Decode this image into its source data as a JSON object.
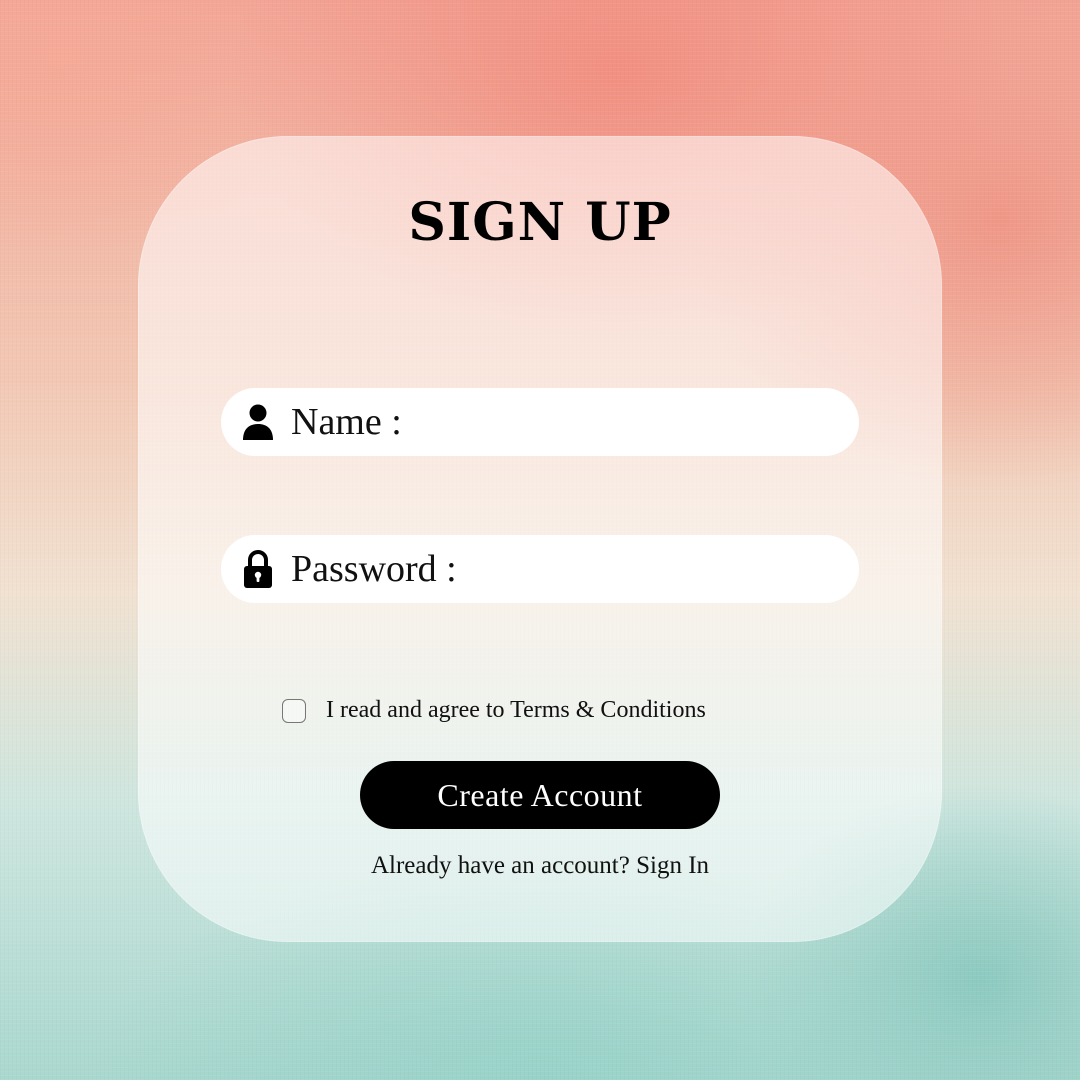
{
  "form": {
    "title": "SIGN UP",
    "name_field": {
      "label": "Name :",
      "icon": "person-icon"
    },
    "password_field": {
      "label": "Password :",
      "icon": "lock-icon"
    },
    "agree": {
      "checked": false,
      "label": "I read and agree to Terms & Conditions"
    },
    "create_button_label": "Create Account",
    "signin_prompt": "Already have an account?",
    "signin_link": "Sign In"
  },
  "colors": {
    "background_top": "#f3a596",
    "background_bottom": "#a9d8cf",
    "button": "#000000",
    "field": "#ffffff"
  }
}
